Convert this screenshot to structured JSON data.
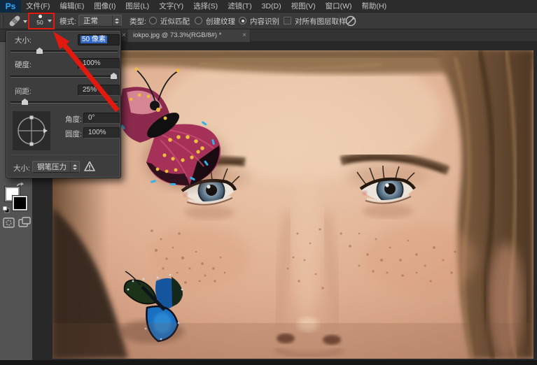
{
  "app": {
    "logo": "Ps"
  },
  "menu": {
    "items": [
      "文件(F)",
      "编辑(E)",
      "图像(I)",
      "图层(L)",
      "文字(Y)",
      "选择(S)",
      "滤镜(T)",
      "3D(D)",
      "视图(V)",
      "窗口(W)",
      "帮助(H)"
    ]
  },
  "options_bar": {
    "brush_size": "50",
    "mode_label": "模式:",
    "mode_value": "正常",
    "type_label": "类型:",
    "radios": [
      {
        "label": "近似匹配",
        "selected": false
      },
      {
        "label": "创建纹理",
        "selected": false
      },
      {
        "label": "内容识别",
        "selected": true
      }
    ],
    "sample_all_layers_label": "对所有图层取样"
  },
  "tabbar": {
    "hidden_tab_close": "×",
    "active_tab_label": "iokpo.jpg @ 73.3%(RGB/8#) *",
    "close_symbol": "×"
  },
  "brush_panel": {
    "size_label": "大小:",
    "size_value": "50 像素",
    "hardness_label": "硬度:",
    "hardness_value": "100%",
    "spacing_label": "间距:",
    "spacing_value": "25%",
    "angle_label": "角度:",
    "angle_value": "0°",
    "roundness_label": "圆度:",
    "roundness_value": "100%",
    "control_label": "大小:",
    "control_value": "钢笔压力"
  },
  "icons": {
    "tool": "spot-healing-brush",
    "warning": "pen-pressure-warning",
    "pressure_toggle": "tablet-pressure-size"
  },
  "colors": {
    "annotation_red": "#e2190e",
    "selection_blue": "#3268c6",
    "ps_blue": "#31a8ff",
    "foreground_swatch": "#ffffff",
    "background_swatch": "#000000"
  }
}
